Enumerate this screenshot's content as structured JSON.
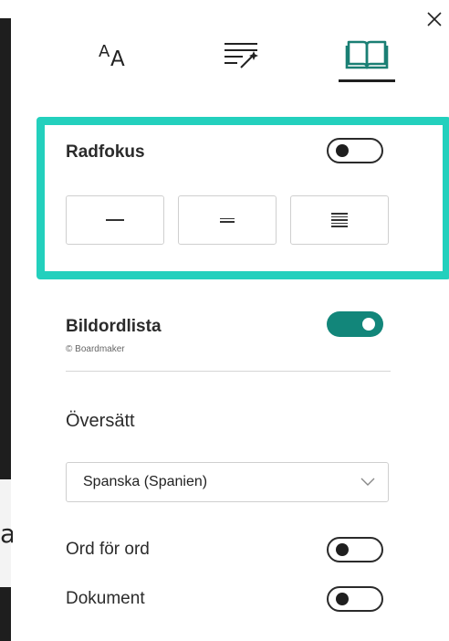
{
  "tabs": [
    {
      "name": "text-preferences",
      "icon": "text-size-icon",
      "glyph": "A"
    },
    {
      "name": "grammar-options",
      "icon": "grammar-wand-icon"
    },
    {
      "name": "reading-preferences",
      "icon": "book-icon",
      "selected": true
    }
  ],
  "line_focus": {
    "label": "Radfokus",
    "enabled": false,
    "options": [
      "1 line",
      "3 lines",
      "5 lines"
    ]
  },
  "picture_dictionary": {
    "label": "Bildordlista",
    "credit": "© Boardmaker",
    "enabled": true
  },
  "translate": {
    "label": "Översätt",
    "language": "Spanska (Spanien)",
    "word_by_word_label": "Ord för ord",
    "word_by_word_enabled": false,
    "document_label": "Dokument",
    "document_enabled": false
  },
  "background_glyph": "a",
  "colors": {
    "highlight": "#23d0bd",
    "toggle_on": "#12867a"
  }
}
